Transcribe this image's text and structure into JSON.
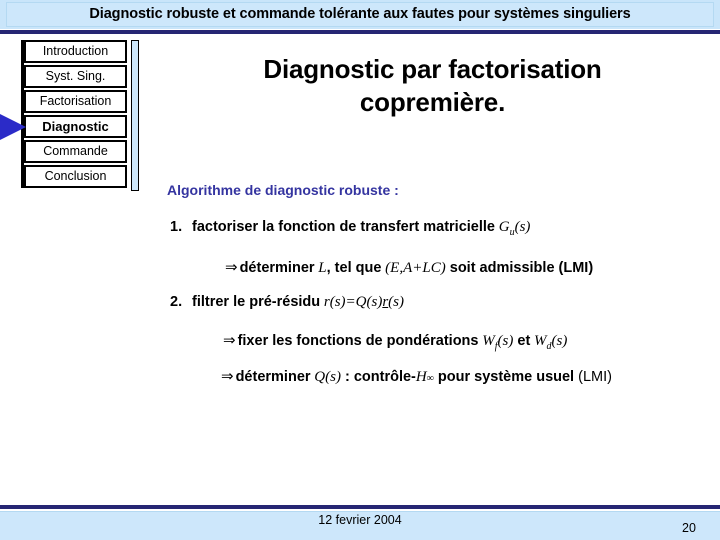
{
  "header": {
    "title": "Diagnostic robuste et commande tolérante aux fautes pour systèmes singuliers",
    "rule_color": "#262673",
    "bg_color": "#cde7fb"
  },
  "sidebar": {
    "items": [
      {
        "label": "Introduction",
        "active": false
      },
      {
        "label": "Syst. Sing.",
        "active": false
      },
      {
        "label": "Factorisation",
        "active": false
      },
      {
        "label": "Diagnostic",
        "active": true
      },
      {
        "label": "Commande",
        "active": false
      },
      {
        "label": "Conclusion",
        "active": false
      }
    ],
    "arrow_color": "#2b2bc8",
    "arrow_target": "Diagnostic"
  },
  "main": {
    "title_line1": "Diagnostic par factorisation",
    "title_line2": "copremière.",
    "algo_heading": "Algorithme de diagnostic robuste :",
    "algo_heading_color": "#3434a0",
    "steps": [
      {
        "number": "1.",
        "text": "factoriser la fonction de transfert matricielle",
        "math": "Gu(s)"
      },
      {
        "arrow": "⇒",
        "text_a": "déterminer",
        "math_a": "L",
        "text_b": ", tel que",
        "math_b": "(E,A+LC)",
        "text_c": "soit admissible (LMI)"
      },
      {
        "number": "2.",
        "text": "filtrer le pré-résidu",
        "math": "r(s)=Q(s)r(s)"
      },
      {
        "arrow": "⇒",
        "text_a": "fixer les fonctions de pondérations",
        "math_a": "Wf(s)",
        "text_b": "et",
        "math_b": "Wd(s)"
      },
      {
        "arrow": "⇒",
        "text_a": "déterminer",
        "math_a": "Q(s)",
        "text_b": ": contrôle-",
        "math_b": "H∞",
        "text_c": "pour système",
        "emphasis": "usuel",
        "text_d": "(LMI)"
      }
    ]
  },
  "footer": {
    "date": "12 fevrier 2004",
    "page_number": "20"
  }
}
